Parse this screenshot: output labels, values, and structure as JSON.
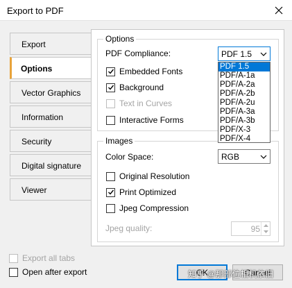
{
  "window": {
    "title": "Export to PDF"
  },
  "tabs": [
    {
      "label": "Export",
      "active": false
    },
    {
      "label": "Options",
      "active": true
    },
    {
      "label": "Vector Graphics",
      "active": false
    },
    {
      "label": "Information",
      "active": false
    },
    {
      "label": "Security",
      "active": false
    },
    {
      "label": "Digital signature",
      "active": false
    },
    {
      "label": "Viewer",
      "active": false
    }
  ],
  "options_group": {
    "title": "Options",
    "pdf_compliance_label": "PDF Compliance:",
    "pdf_compliance_value": "PDF 1.5",
    "pdf_compliance_options": [
      "PDF 1.5",
      "PDF/A-1a",
      "PDF/A-2a",
      "PDF/A-2b",
      "PDF/A-2u",
      "PDF/A-3a",
      "PDF/A-3b",
      "PDF/X-3",
      "PDF/X-4"
    ],
    "embedded_fonts": {
      "label": "Embedded Fonts",
      "checked": true
    },
    "background": {
      "label": "Background",
      "checked": true
    },
    "text_in_curves": {
      "label": "Text in Curves",
      "checked": false,
      "disabled": true
    },
    "interactive_forms": {
      "label": "Interactive Forms",
      "checked": false
    }
  },
  "images_group": {
    "title": "Images",
    "color_space_label": "Color Space:",
    "color_space_value": "RGB",
    "original_resolution": {
      "label": "Original Resolution",
      "checked": false
    },
    "print_optimized": {
      "label": "Print Optimized",
      "checked": true
    },
    "jpeg_compression": {
      "label": "Jpeg Compression",
      "checked": false
    },
    "jpeg_quality_label": "Jpeg quality:",
    "jpeg_quality_value": "95"
  },
  "footer": {
    "export_all_tabs": {
      "label": "Export all tabs",
      "checked": false,
      "disabled": true
    },
    "open_after_export": {
      "label": "Open after export",
      "checked": false
    },
    "ok_label": "OK",
    "cancel_label": "Cancel"
  },
  "watermark": {
    "text": "知乎 @那部位相机依旧"
  },
  "colors": {
    "accent": "#0078d7",
    "tab_marker": "#e8a33a"
  }
}
